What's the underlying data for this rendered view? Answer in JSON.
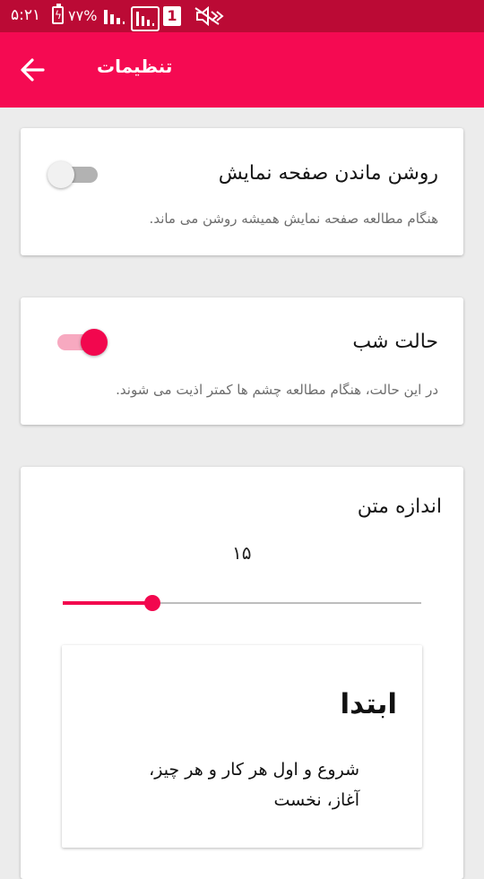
{
  "status_bar": {
    "time": "۵:۲۱",
    "battery_percent": "۷۷%",
    "battery_icon": "battery-charging-icon",
    "sim_label": "1",
    "icons": [
      "signal-icon",
      "signal-icon",
      "sim-icon",
      "mute-icon"
    ]
  },
  "app_bar": {
    "title": "تنظیمات",
    "back_icon": "arrow-back-icon",
    "color": "#f50a52"
  },
  "settings": {
    "keep_screen_on": {
      "title": "روشن ماندن صفحه نمایش",
      "description": "هنگام مطالعه صفحه نمایش همیشه روشن می ماند.",
      "enabled": false
    },
    "night_mode": {
      "title": "حالت شب",
      "description": "در این حالت، هنگام مطالعه چشم ها کمتر اذیت می شوند.",
      "enabled": true
    },
    "text_size": {
      "title": "اندازه متن",
      "value_label": "۱۵",
      "slider_fraction": 0.25
    }
  },
  "preview": {
    "word": "ابتدا",
    "meaning": "شروع و اول هر کار و هر چیز، آغاز، نخست"
  },
  "colors": {
    "accent": "#f2074e",
    "status_bar": "#bb0a35"
  }
}
